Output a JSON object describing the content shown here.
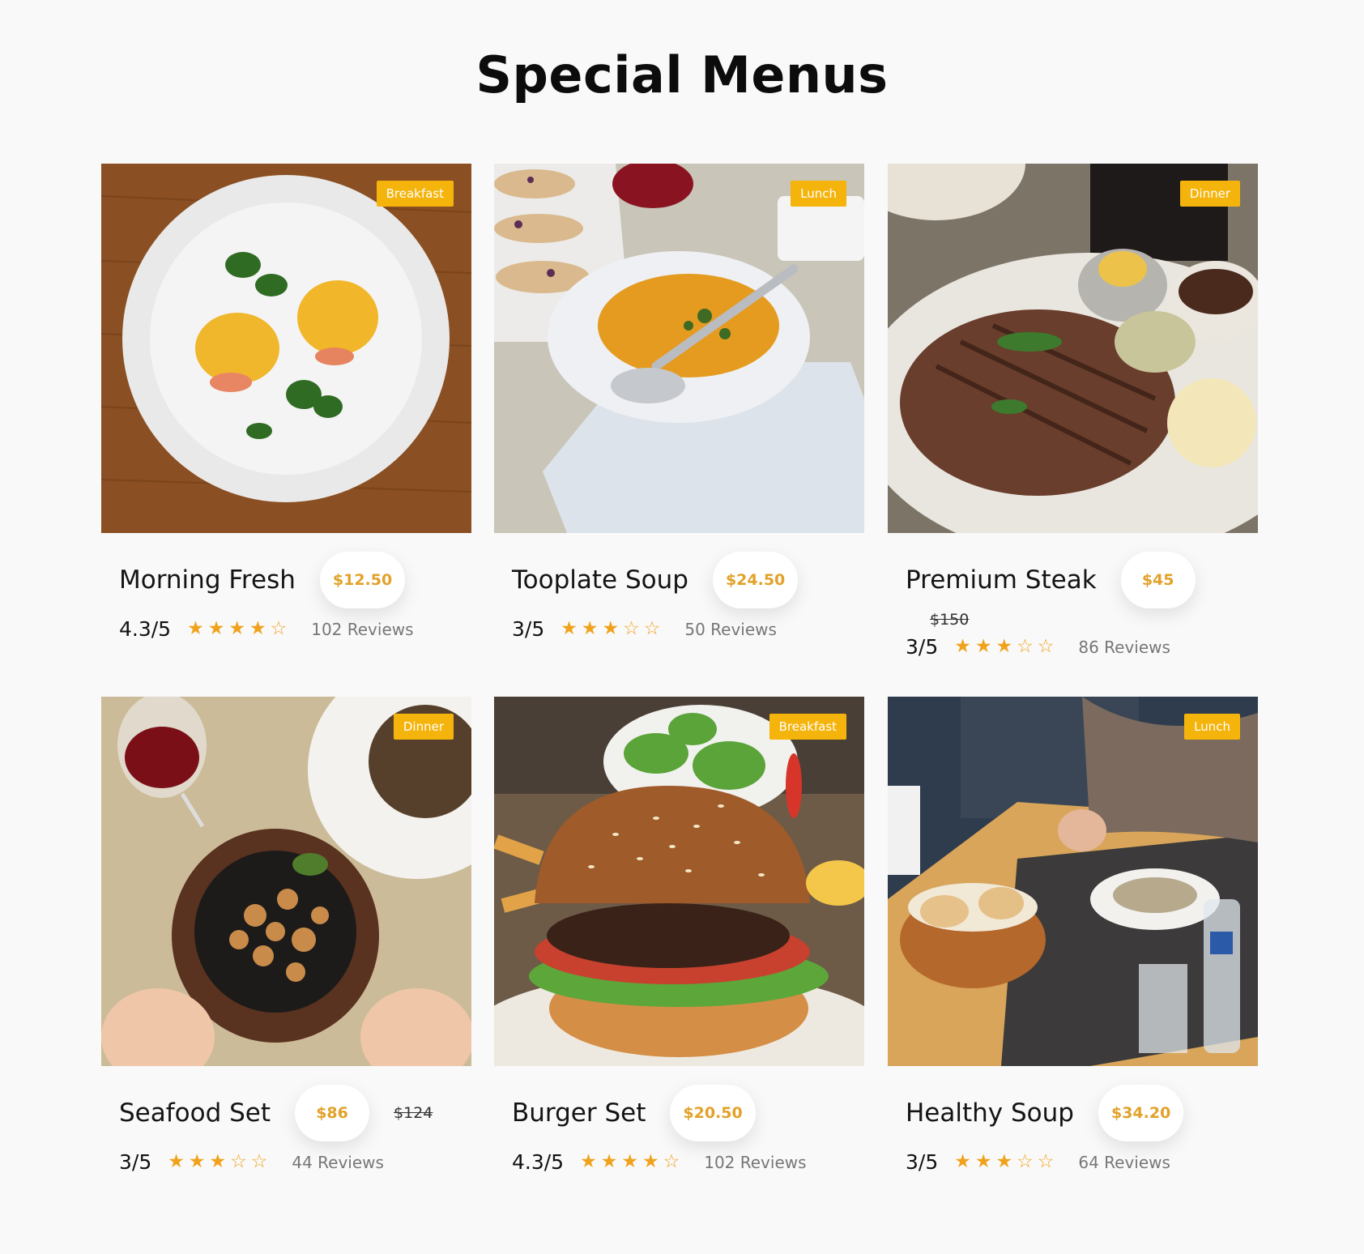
{
  "page": {
    "title": "Special Menus"
  },
  "colors": {
    "accent": "#f5b40b",
    "price": "#e2a22a",
    "star": "#f0a21c",
    "background": "#f9f9f9"
  },
  "menus": [
    {
      "name": "Morning Fresh",
      "category": "Breakfast",
      "price": "$12.50",
      "old_price": "",
      "rating": "4.3/5",
      "stars": [
        1,
        1,
        1,
        1,
        0
      ],
      "reviews": "102 Reviews",
      "image": "eggs-benedict-plate"
    },
    {
      "name": "Tooplate Soup",
      "category": "Lunch",
      "price": "$24.50",
      "old_price": "",
      "rating": "3/5",
      "stars": [
        1,
        1,
        1,
        0,
        0
      ],
      "reviews": "50 Reviews",
      "image": "soup-bowl-with-spoon"
    },
    {
      "name": "Premium Steak",
      "category": "Dinner",
      "price": "$45",
      "old_price": "$150",
      "rating": "3/5",
      "stars": [
        1,
        1,
        1,
        0,
        0
      ],
      "reviews": "86 Reviews",
      "image": "grilled-steak-plate"
    },
    {
      "name": "Seafood Set",
      "category": "Dinner",
      "price": "$86",
      "old_price": "$124",
      "rating": "3/5",
      "stars": [
        1,
        1,
        1,
        0,
        0
      ],
      "reviews": "44 Reviews",
      "image": "seafood-skillet-with-wine"
    },
    {
      "name": "Burger Set",
      "category": "Breakfast",
      "price": "$20.50",
      "old_price": "",
      "rating": "4.3/5",
      "stars": [
        1,
        1,
        1,
        1,
        0
      ],
      "reviews": "102 Reviews",
      "image": "sesame-burger"
    },
    {
      "name": "Healthy Soup",
      "category": "Lunch",
      "price": "$34.20",
      "old_price": "",
      "rating": "3/5",
      "stars": [
        1,
        1,
        1,
        0,
        0
      ],
      "reviews": "64 Reviews",
      "image": "soup-and-bread-basket"
    }
  ]
}
